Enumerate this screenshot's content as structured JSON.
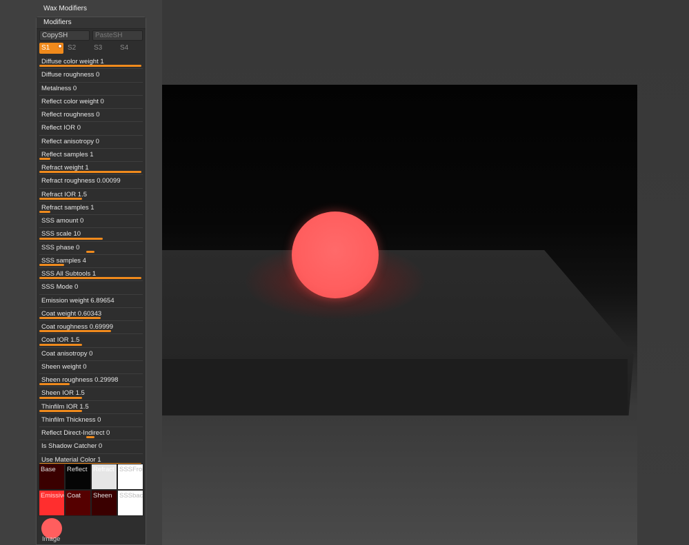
{
  "header": {
    "title": "Wax Modifiers"
  },
  "panel": {
    "title": "Modifiers",
    "copy_label": "CopySH",
    "paste_label": "PasteSH",
    "slots": [
      "S1",
      "S2",
      "S3",
      "S4"
    ],
    "active_slot": "S1",
    "accent_color": "#f08a1c"
  },
  "sliders": [
    {
      "label": "Diffuse color weight 1",
      "fill": 1.0
    },
    {
      "label": "Diffuse roughness 0",
      "fill": 0.0
    },
    {
      "label": "Metalness 0",
      "fill": 0.0
    },
    {
      "label": "Reflect color weight 0",
      "fill": 0.0
    },
    {
      "label": "Reflect roughness 0",
      "fill": 0.0
    },
    {
      "label": "Reflect IOR 0",
      "fill": 0.0
    },
    {
      "label": "Reflect anisotropy 0",
      "fill": 0.0
    },
    {
      "label": "Reflect samples 1",
      "fill": 0.11
    },
    {
      "label": "Refract weight 1",
      "fill": 1.0
    },
    {
      "label": "Refract roughness 0.00099",
      "fill": 0.0
    },
    {
      "label": "Refract IOR 1.5",
      "fill": 0.42
    },
    {
      "label": "Refract samples 1",
      "fill": 0.11
    },
    {
      "label": "SSS amount 0",
      "fill": 0.0
    },
    {
      "label": "SSS scale 10",
      "fill": 0.62
    },
    {
      "label": "SSS phase 0",
      "fill": 0.5,
      "mode": "center"
    },
    {
      "label": "SSS samples 4",
      "fill": 0.24
    },
    {
      "label": "SSS All Subtools 1",
      "fill": 1.0
    },
    {
      "label": "SSS Mode 0",
      "fill": 0.0
    },
    {
      "label": "Emission weight 6.89654",
      "fill": 0.0
    },
    {
      "label": "Coat weight 0.60343",
      "fill": 0.6
    },
    {
      "label": "Coat roughness 0.69999",
      "fill": 0.7
    },
    {
      "label": "Coat IOR 1.5",
      "fill": 0.42
    },
    {
      "label": "Coat anisotropy 0",
      "fill": 0.0
    },
    {
      "label": "Sheen weight 0",
      "fill": 0.0
    },
    {
      "label": "Sheen roughness 0.29998",
      "fill": 0.3
    },
    {
      "label": "Sheen IOR 1.5",
      "fill": 0.42
    },
    {
      "label": "Thinfilm IOR 1.5",
      "fill": 0.42
    },
    {
      "label": "Thinfilm Thickness 0",
      "fill": 0.0
    },
    {
      "label": "Reflect Direct-Indirect 0",
      "fill": 0.5,
      "mode": "center"
    },
    {
      "label": "Is Shadow Catcher 0",
      "fill": 0.0
    },
    {
      "label": "Use Material Color 1",
      "fill": 1.0
    }
  ],
  "swatches": [
    {
      "label": "Base",
      "color": "#3a0000",
      "text_color": "#e0e0e0"
    },
    {
      "label": "Reflect",
      "color": "#050505",
      "text_color": "#e0e0e0"
    },
    {
      "label": "Refract",
      "color": "#e6e6e6",
      "text_color": "#ffffff"
    },
    {
      "label": "SSSFront",
      "color": "#ffffff",
      "text_color": "#bbbbbb"
    },
    {
      "label": "Emissive",
      "color": "#ff2e2e",
      "text_color": "#ffd0d0"
    },
    {
      "label": "Coat",
      "color": "#550000",
      "text_color": "#e0e0e0"
    },
    {
      "label": "Sheen",
      "color": "#3a0000",
      "text_color": "#e0e0e0"
    },
    {
      "label": "SSSback",
      "color": "#ffffff",
      "text_color": "#bbbbbb"
    }
  ],
  "image_well": {
    "label": "Image",
    "color": "#ff5e5e"
  }
}
